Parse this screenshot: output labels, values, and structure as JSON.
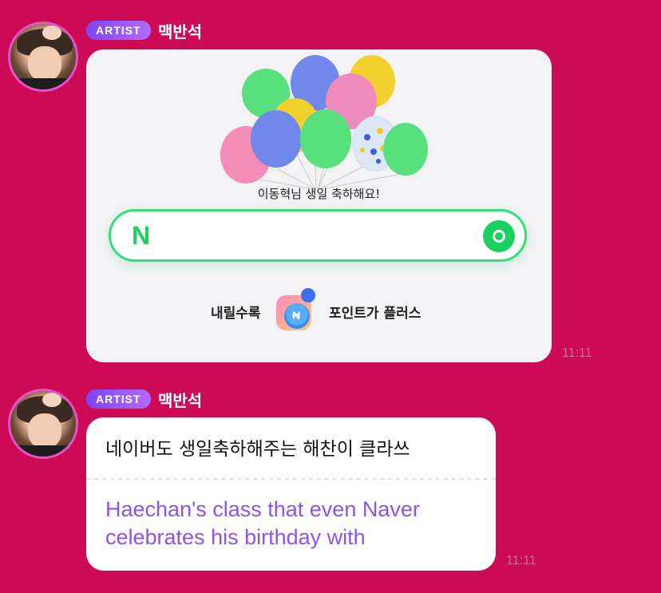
{
  "messages": [
    {
      "badge": "ARTIST",
      "sender": "맥반석",
      "time": "11:11",
      "card": {
        "balloon_caption": "이동혁님 생일 축하해요!",
        "search_logo": "N",
        "promo_left": "내릴수록",
        "promo_right": "포인트가 플러스"
      }
    },
    {
      "badge": "ARTIST",
      "sender": "맥반석",
      "time": "11:11",
      "text": "네이버도 생일축하해주는 해찬이 클라쓰",
      "translation": "Haechan's class that even Naver celebrates his birthday with"
    }
  ],
  "colors": {
    "background": "#cc0a55",
    "badge_start": "#7b46f5",
    "badge_end": "#b36bff",
    "naver_green": "#19d05c",
    "translation_text": "#8a55ef"
  }
}
